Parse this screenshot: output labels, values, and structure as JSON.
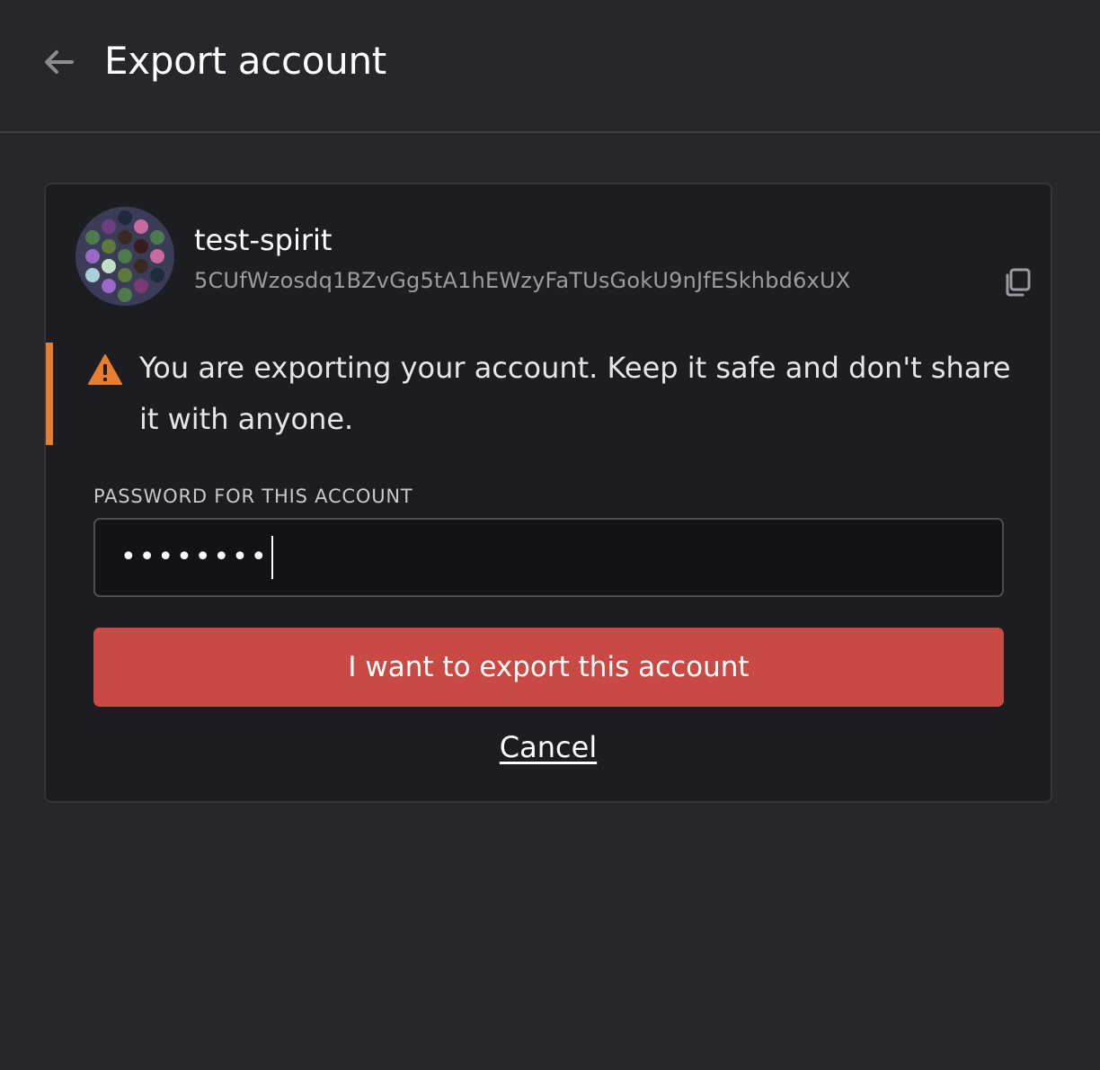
{
  "header": {
    "title": "Export account",
    "back_icon": "arrow-left-icon"
  },
  "account": {
    "name": "test-spirit",
    "address": "5CUfWzosdq1BZvGg5tA1hEWzyFaTUsGokU9nJfESkhbd6xUX",
    "copy_icon": "copy-icon"
  },
  "warning": {
    "icon": "warning-triangle-icon",
    "text": "You are exporting your account. Keep it safe and don't share it with anyone.",
    "accent_color": "#e67e2e"
  },
  "password_field": {
    "label": "PASSWORD FOR THIS ACCOUNT",
    "masked_value": "••••••••"
  },
  "actions": {
    "export_label": "I want to export this account",
    "export_color": "#c94a44",
    "cancel_label": "Cancel"
  }
}
